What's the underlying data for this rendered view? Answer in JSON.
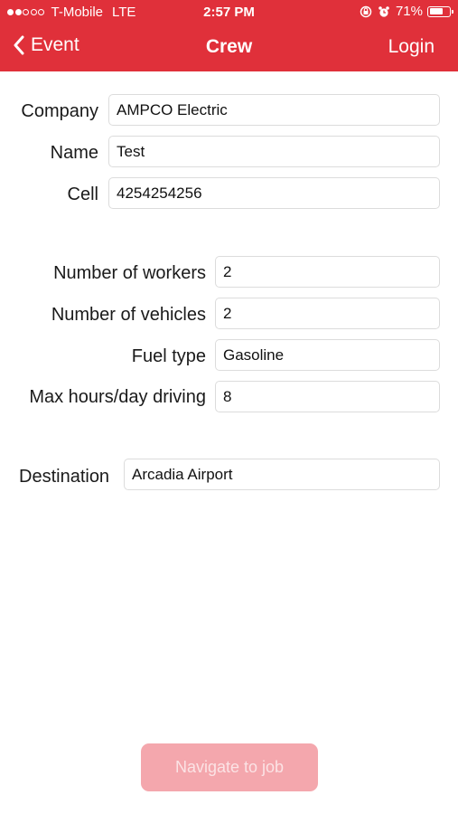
{
  "status_bar": {
    "carrier": "T-Mobile",
    "network": "LTE",
    "time": "2:57 PM",
    "battery_percent": "71%",
    "battery_level": 0.71,
    "signal_bars_filled": 2,
    "signal_bars_total": 5
  },
  "nav": {
    "back_label": "Event",
    "title": "Crew",
    "right_label": "Login"
  },
  "form": {
    "company_label": "Company",
    "company_value": "AMPCO Electric",
    "name_label": "Name",
    "name_value": "Test",
    "cell_label": "Cell",
    "cell_value": "4254254256",
    "workers_label": "Number of workers",
    "workers_value": "2",
    "vehicles_label": "Number of vehicles",
    "vehicles_value": "2",
    "fuel_label": "Fuel type",
    "fuel_value": "Gasoline",
    "hours_label": "Max hours/day driving",
    "hours_value": "8",
    "destination_label": "Destination",
    "destination_value": "Arcadia Airport"
  },
  "actions": {
    "navigate_label": "Navigate to job"
  },
  "colors": {
    "brand": "#e0303a",
    "button_disabled": "#f4a7ad"
  }
}
